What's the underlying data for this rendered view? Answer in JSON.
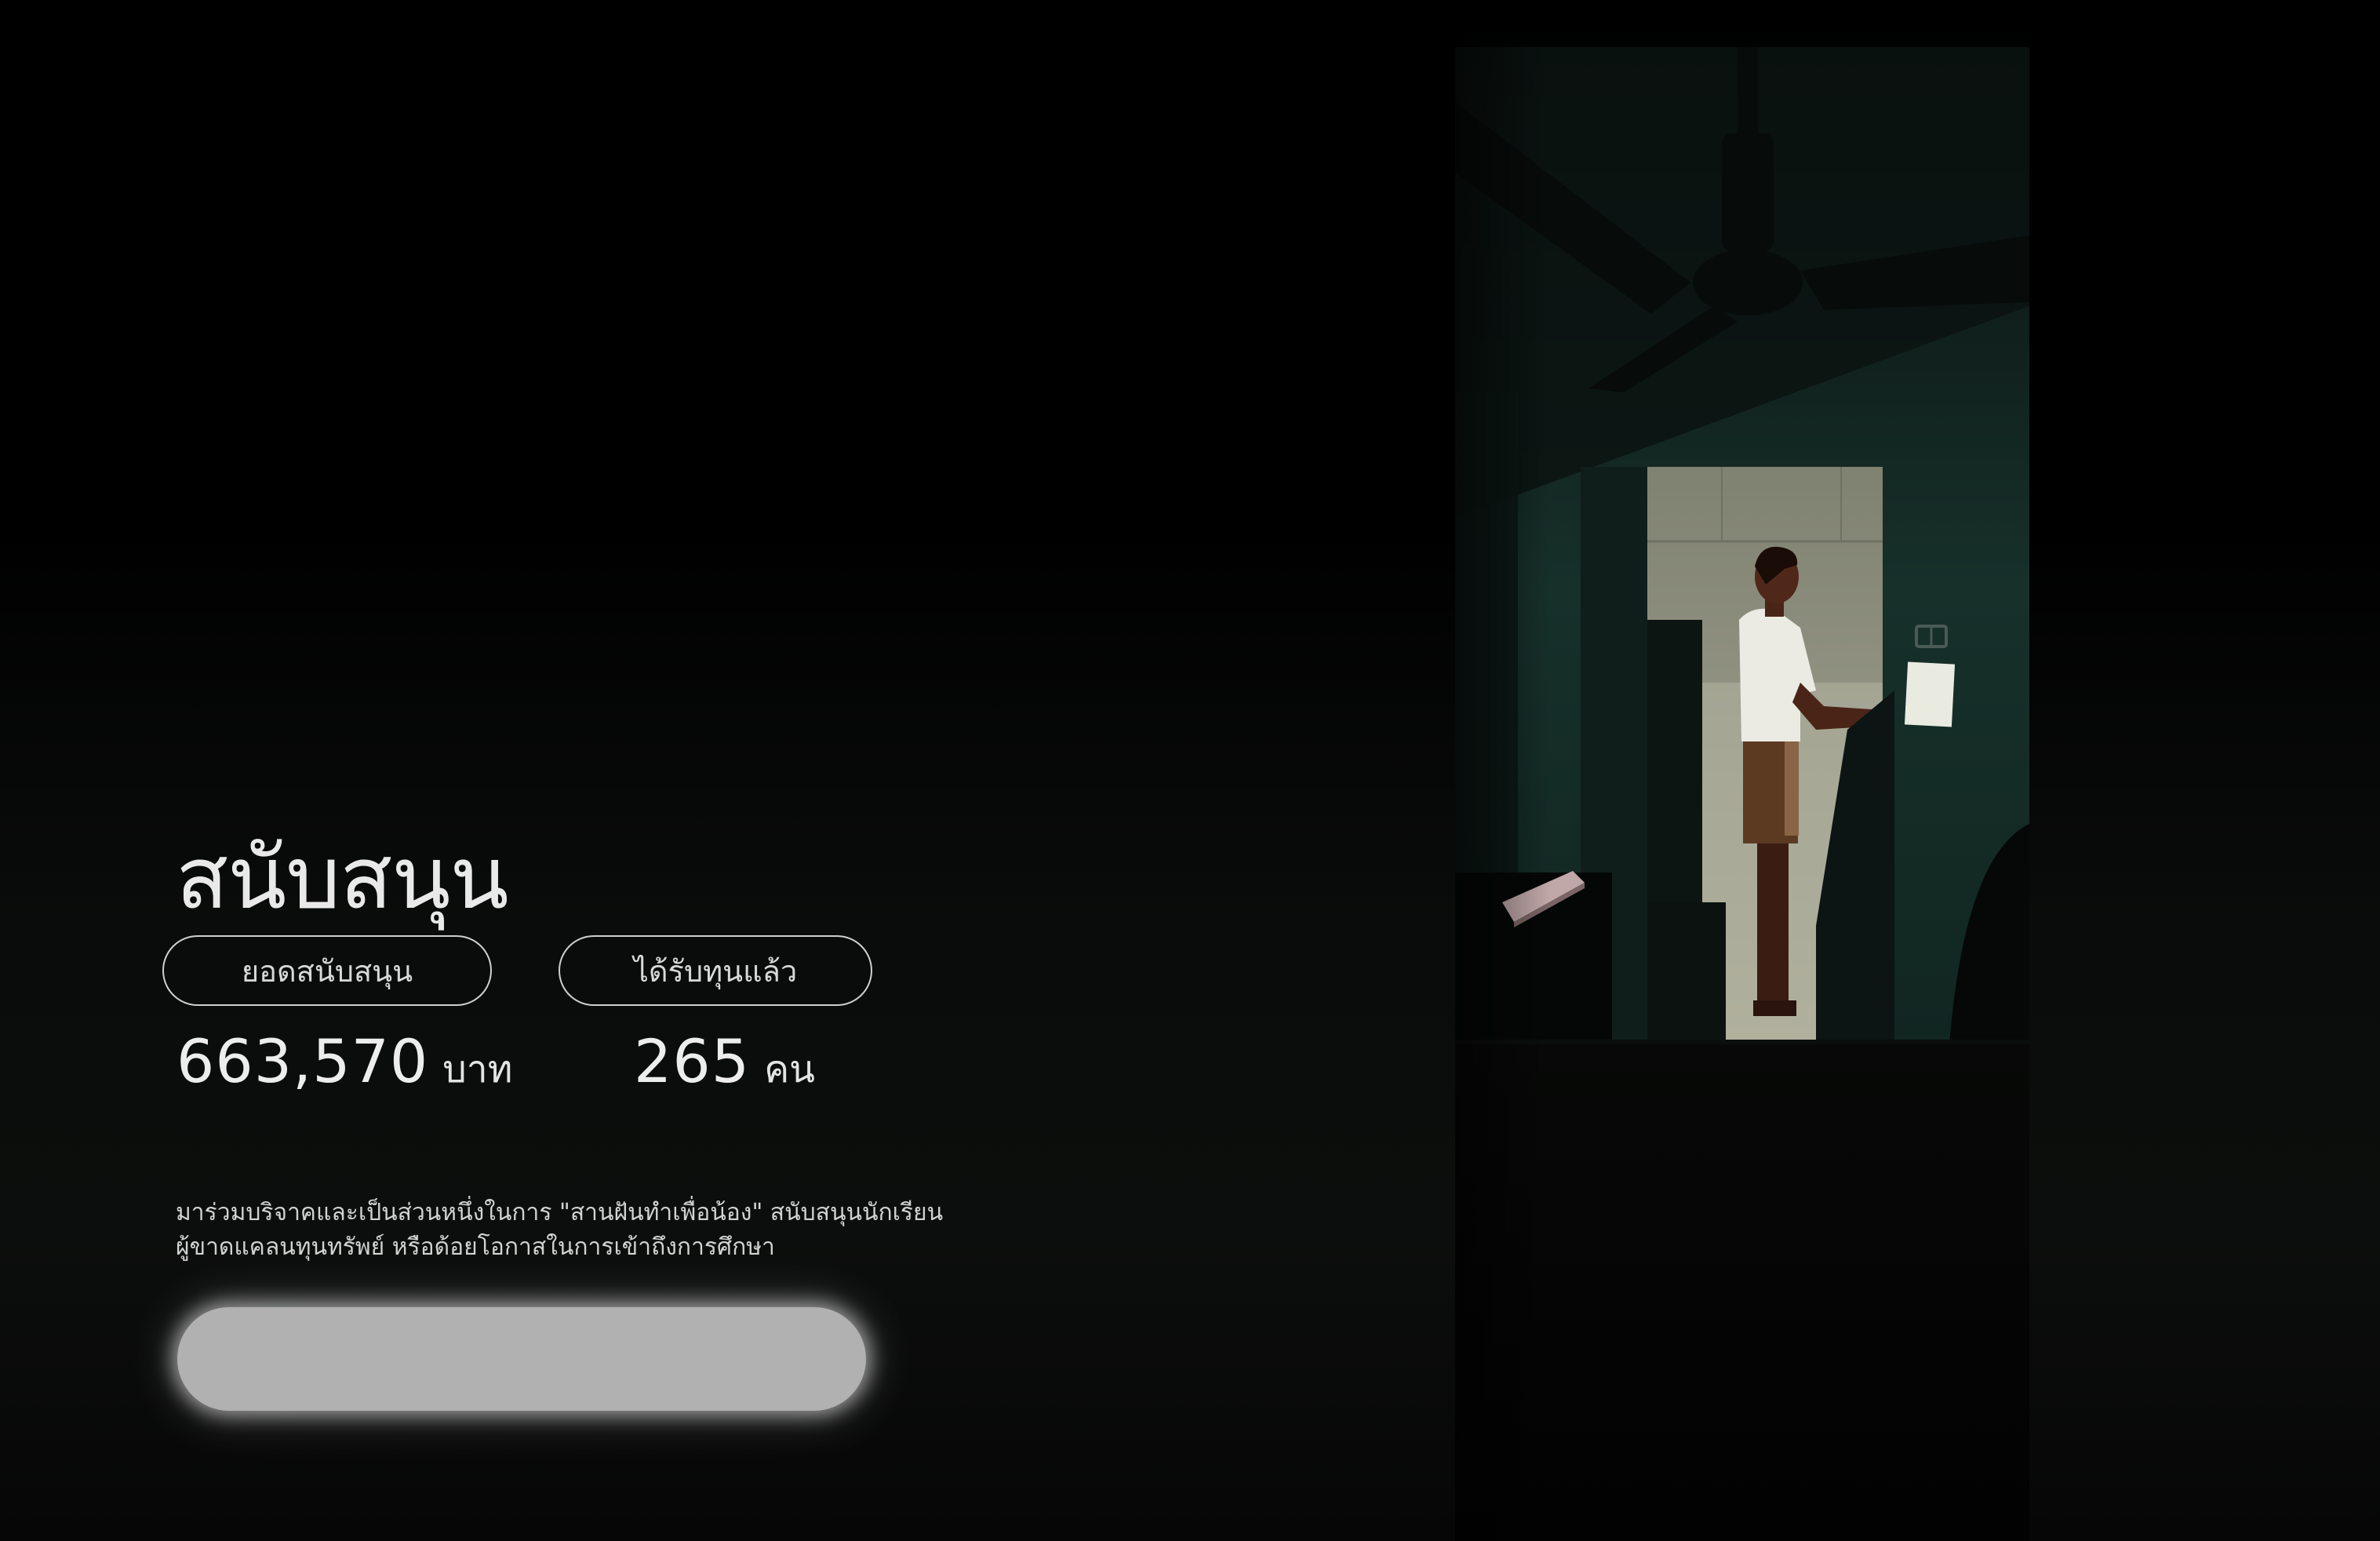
{
  "support": {
    "title": "สนับสนุน",
    "donation_label": "ยอดสนับสนุน",
    "donation_value": "663,570",
    "donation_unit": "บาท",
    "recipients_label": "ได้รับทุนแล้ว",
    "recipients_value": "265",
    "recipients_unit": "คน",
    "description_line1": "มาร่วมบริจาคและเป็นส่วนหนึ่งในการ \"สานฝันทำเพื่อน้อง\" สนับสนุนนักเรียน",
    "description_line2": "ผู้ขาดแคลนทุนทรัพย์ หรือด้อยโอกาสในการเข้าถึงการศึกษา",
    "cta_label": ""
  },
  "illustration": {
    "subject": "person-at-counter",
    "colors": {
      "wall": "#163029",
      "doorway": "#8c8e7c",
      "shirt": "#eceae2",
      "skin": "#5a2f1f",
      "paper": "#e9ebe1"
    }
  }
}
